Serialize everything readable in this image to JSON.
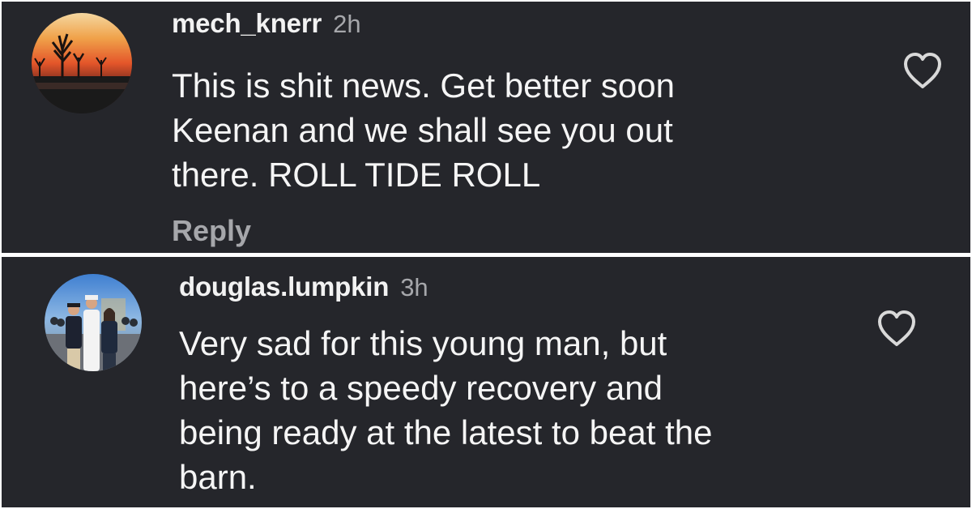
{
  "comments": [
    {
      "username": "mech_knerr",
      "time": "2h",
      "text": "This is shit news.  Get better soon\nKeenan and we shall see you out\nthere.  ROLL TIDE ROLL",
      "reply_label": "Reply",
      "avatar_icon": "sunset-photo-avatar",
      "like_icon": "heart-outline-icon"
    },
    {
      "username": "douglas.lumpkin",
      "time": "3h",
      "text": "Very sad for this young man, but\nhere’s to a speedy recovery and\nbeing ready at the latest to beat the\nbarn.",
      "avatar_icon": "group-photo-avatar",
      "like_icon": "heart-outline-icon"
    }
  ],
  "colors": {
    "background": "#25262b",
    "text": "#f5f5f5",
    "muted": "#a6a7ab"
  }
}
